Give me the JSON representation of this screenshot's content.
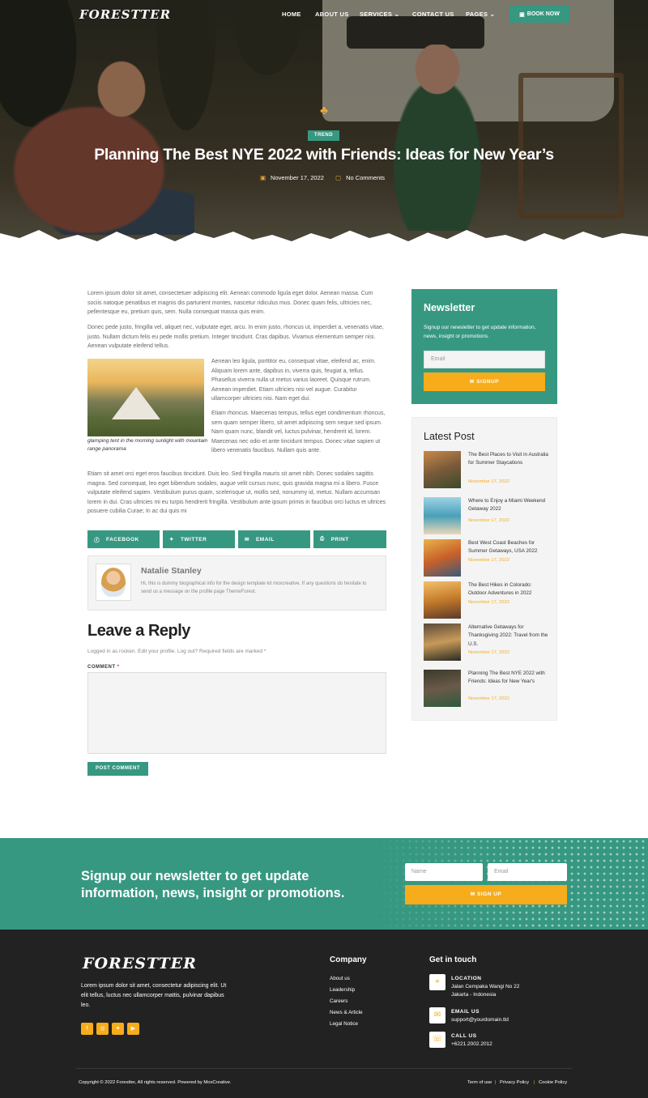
{
  "nav": {
    "logo": "FORESTTER",
    "items": [
      "HOME",
      "ABOUT US",
      "SERVICES",
      "CONTACT US",
      "PAGES"
    ],
    "book_label": "BOOK NOW"
  },
  "hero": {
    "tag": "TREND",
    "title": "Planning The Best NYE 2022 with Friends: Ideas for New Year’s",
    "date": "November 17, 2022",
    "comments": "No Comments"
  },
  "article": {
    "p1": "Lorem ipsum dolor sit amet, consectetuer adipiscing elit. Aenean commodo ligula eget dolor. Aenean massa. Cum sociis natoque penatibus et magnis dis parturient montes, nascetur ridiculus mus. Donec quam felis, ultricies nec, pellentesque eu, pretium quis, sem. Nulla consequat massa quis enim.",
    "p2": "Donec pede justo, fringilla vel, aliquet nec, vulputate eget, arcu. In enim justo, rhoncus ut, imperdiet a, venenatis vitae, justo. Nullam dictum felis eu pede mollis pretium. Integer tincidunt. Cras dapibus. Vivamus elementum semper nisi. Aenean vulputate eleifend tellus.",
    "p3": "Aenean leo ligula, porttitor eu, consequat vitae, eleifend ac, enim. Aliquam lorem ante, dapibus in, viverra quis, feugiat a, tellus. Phasellus viverra nulla ut metus varius laoreet. Quisque rutrum. Aenean imperdiet. Etiam ultricies nisi vel augue. Curabitur ullamcorper ultricies nisi. Nam eget dui.",
    "p4": "Etiam rhoncus. Maecenas tempus, tellus eget condimentum rhoncus, sem quam semper libero, sit amet adipiscing sem neque sed ipsum. Nam quam nunc, blandit vel, luctus pulvinar, hendrerit id, lorem. Maecenas nec odio et ante tincidunt tempus. Donec vitae sapien ut libero venenatis faucibus. Nullam quis ante.",
    "p5": "Etiam sit amet orci eget eros faucibus tincidunt. Duis leo. Sed fringilla mauris sit amet nibh. Donec sodales sagittis magna. Sed consequat, leo eget bibendum sodales, augue velit cursus nunc, quis gravida magna mi a libero. Fusce vulputate eleifend sapien. Vestibulum purus quam, scelerisque ut, mollis sed, nonummy id, metus. Nullam accumsan lorem in dui. Cras ultricies mi eu turpis hendrerit fringilla. Vestibulum ante ipsum primis in faucibus orci luctus et ultrices posuere cubilia Curae; In ac dui quis mi",
    "caption": "glamping tent in the morning sunlight with mountain range panorama"
  },
  "share": [
    "FACEBOOK",
    "TWITTER",
    "EMAIL",
    "PRINT"
  ],
  "author": {
    "name": "Natalie Stanley",
    "bio": "Hi, this is dummy biographical info for the design template kit moxcreative. If any questions do hesitate to send us a message on the profile page ThemeForest."
  },
  "reply": {
    "heading": "Leave a Reply",
    "logged": "Logged in as rocken. Edit your profile. Log out? Required fields are marked *",
    "comment_label": "COMMENT",
    "required_mark": "*",
    "post_label": "POST COMMENT"
  },
  "sidebar_newsletter": {
    "title": "Newsletter",
    "text": "Signup our newsletter to get update information, news, insight or promotions.",
    "email_placeholder": "Email",
    "button": "SIGNUP"
  },
  "latest": {
    "title": "Latest Post",
    "posts": [
      {
        "title": "The Best Places to Visit in Australia for Summer Staycations",
        "date": "November 17, 2022"
      },
      {
        "title": "Where to Enjoy a Miami Weekend Getaway 2022",
        "date": "November 17, 2022"
      },
      {
        "title": "Best West Coast Beaches for Summer Getaways, USA 2022",
        "date": "November 17, 2022"
      },
      {
        "title": "The Best Hikes in Colorado: Outdoor Adventures in 2022",
        "date": "November 17, 2022"
      },
      {
        "title": "Alternative Getaways for Thanksgiving 2022: Travel from the U.S.",
        "date": "November 17, 2022"
      },
      {
        "title": "Planning The Best NYE 2022 with Friends: Ideas for New Year's",
        "date": "November 17, 2022"
      }
    ]
  },
  "band": {
    "heading": "Signup our newsletter to get update information, news, insight or promotions.",
    "name_placeholder": "Name",
    "email_placeholder": "Email",
    "button": "SIGN UP"
  },
  "footer": {
    "logo": "FORESTTER",
    "text": "Lorem ipsum dolor sit amet, consectetur adipiscing elit. Ut elit tellus, luctus nec ullamcorper mattis, pulvinar dapibus leo.",
    "company_heading": "Company",
    "company_links": [
      "About us",
      "Leadership",
      "Careers",
      "News & Article",
      "Legal Notice"
    ],
    "touch_heading": "Get in touch",
    "location_label": "LOCATION",
    "location_value": "Jalan Cempaka Wangi No 22",
    "location_value2": "Jakarta - Indonesia",
    "email_label": "EMAIL US",
    "email_value": "support@yourdomain.tld",
    "call_label": "CALL US",
    "call_value": "+6221.2002.2012",
    "copyright": "Copyright © 2022 Forestter, All rights reserved. Powered by MoxCreative.",
    "legal": [
      "Term of use",
      "Privacy Policy",
      "Cookie Policy"
    ]
  },
  "colors": {
    "primary": "#379881",
    "accent": "#f6ac1b",
    "dark": "#222222"
  }
}
